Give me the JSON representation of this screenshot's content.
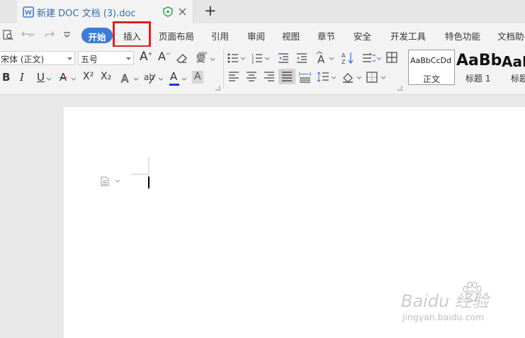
{
  "document_tab": {
    "title": "新建 DOC 文档 (3).doc"
  },
  "new_tab": {
    "label": "+"
  },
  "ribbon": {
    "tabs": [
      "开始",
      "插入",
      "页面布局",
      "引用",
      "审阅",
      "视图",
      "章节",
      "安全",
      "开发工具",
      "特色功能",
      "文档助手"
    ],
    "active_tab": "开始",
    "highlighted_tab": "插入"
  },
  "font": {
    "name": "宋体 (正文)",
    "size": "五号"
  },
  "format_buttons": {
    "bold": "B",
    "italic": "I",
    "underline": "U",
    "strike": "A",
    "superscript": "X²",
    "subscript": "X₂",
    "font_color": "A",
    "char_shade": "A"
  },
  "styles": [
    {
      "preview": "AaBbCcDd",
      "name": "正文"
    },
    {
      "preview": "AaBb",
      "name": "标题 1"
    },
    {
      "preview": "AaB",
      "name": "标题"
    }
  ],
  "watermark": {
    "main": "Baidu 经验",
    "sub": "jingyan.baidu.com"
  },
  "colors": {
    "accent_blue": "#3d7bd8",
    "highlight_red": "#e32020",
    "font_color_underline": "#1a39d6"
  }
}
